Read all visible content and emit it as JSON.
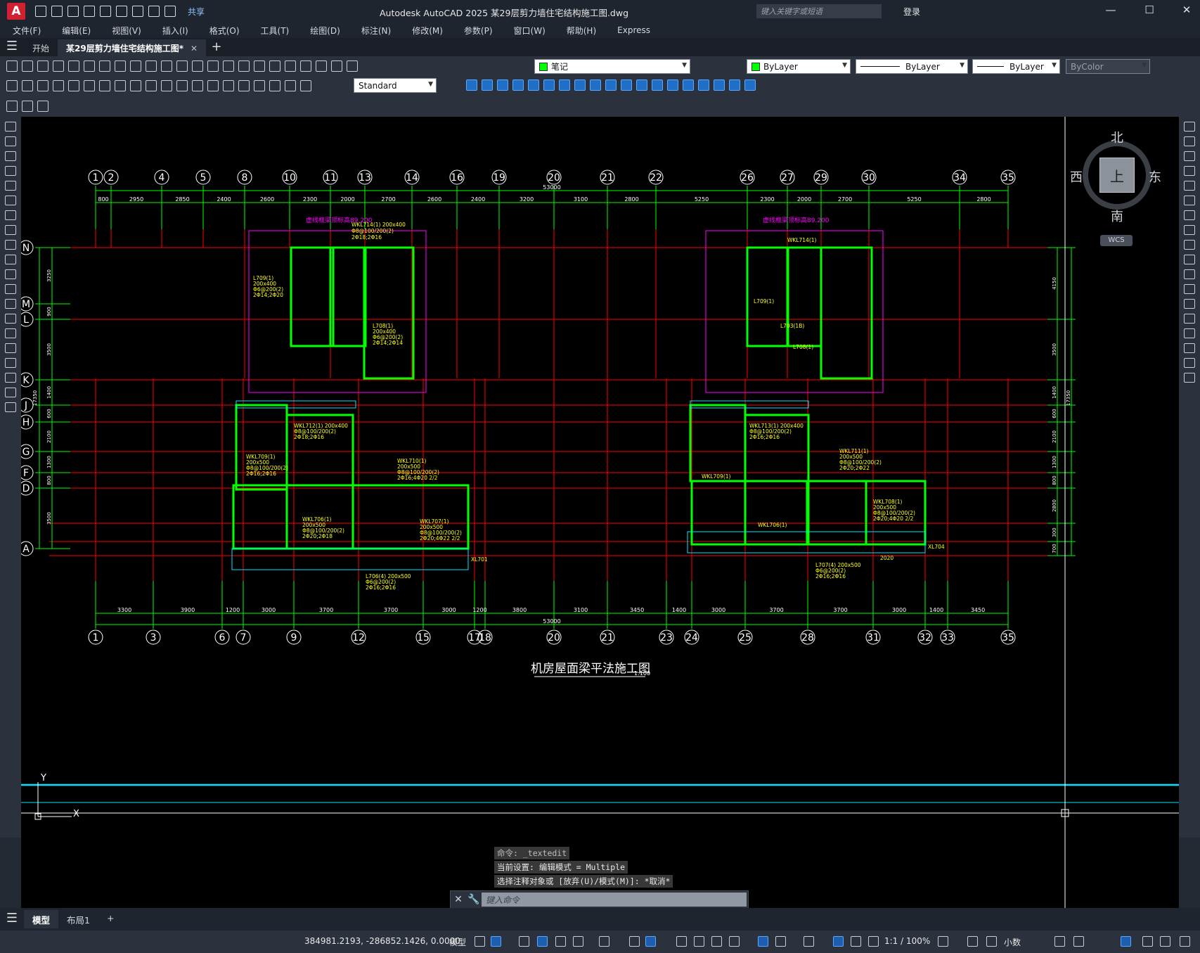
{
  "app": {
    "logo_letter": "A",
    "title": "Autodesk AutoCAD 2025    某29层剪力墙住宅结构施工图.dwg",
    "share_label": "共享",
    "search_placeholder": "键入关键字或短语",
    "login_label": "登录"
  },
  "menu": [
    "文件(F)",
    "编辑(E)",
    "视图(V)",
    "插入(I)",
    "格式(O)",
    "工具(T)",
    "绘图(D)",
    "标注(N)",
    "修改(M)",
    "参数(P)",
    "窗口(W)",
    "帮助(H)",
    "Express"
  ],
  "tabs": {
    "start": "开始",
    "document": "某29层剪力墙住宅结构施工图*"
  },
  "toolbar": {
    "layer_name": "笔记",
    "text_style": "Standard",
    "color": "ByLayer",
    "linetype": "ByLayer",
    "lineweight": "ByLayer",
    "plotstyle": "ByColor"
  },
  "viewcube": {
    "north": "北",
    "south": "南",
    "east": "东",
    "west": "西",
    "face": "上",
    "wcs": "WCS"
  },
  "drawing": {
    "title": "机房屋面梁平法施工图",
    "scale": "1:100",
    "total_dim": "53000",
    "top_axes": [
      "1",
      "2",
      "4",
      "5",
      "8",
      "10",
      "11",
      "13",
      "14",
      "16",
      "19",
      "20",
      "21",
      "22",
      "26",
      "27",
      "29",
      "30",
      "34",
      "35"
    ],
    "top_dims": [
      "800",
      "2950",
      "2850",
      "2400",
      "2600",
      "2300",
      "2000",
      "2700",
      "2600",
      "2400",
      "3200",
      "3100",
      "2800",
      "5250",
      "2300",
      "2000",
      "2700",
      "5250",
      "2800"
    ],
    "bottom_axes": [
      "1",
      "3",
      "6",
      "7",
      "9",
      "12",
      "15",
      "17",
      "18",
      "20",
      "21",
      "23",
      "24",
      "25",
      "28",
      "31",
      "32",
      "33",
      "35"
    ],
    "bottom_dims": [
      "3300",
      "3900",
      "1200",
      "3000",
      "3700",
      "3700",
      "3000",
      "1200",
      "3800",
      "3100",
      "3450",
      "1400",
      "3000",
      "3700",
      "3700",
      "3000",
      "1400",
      "3450"
    ],
    "left_axes": [
      "N",
      "M",
      "L",
      "K",
      "J",
      "H",
      "G",
      "F",
      "D",
      "A"
    ],
    "left_dims": [
      "3250",
      "900",
      "3500",
      "1400",
      "600",
      "2100",
      "1300",
      "800",
      "3500"
    ],
    "left_total": "17350",
    "right_dims": [
      "4150",
      "3500",
      "1400",
      "600",
      "2100",
      "1300",
      "800",
      "2800",
      "300",
      "700"
    ],
    "right_total": "17350",
    "note_left": "虚线框梁顶标高89.200",
    "note_right": "虚线框梁顶标高89.200",
    "beam_labels": [
      "WKL714(1) 200x400",
      "Φ8@100/200(2)",
      "2Φ18;2Φ16",
      "L709(1)",
      "200x400",
      "Φ6@200(2)",
      "2Φ14;2Φ20",
      "L708(1)",
      "200x400",
      "Φ6@200(2)",
      "2Φ14;2Φ14",
      "WKL714(1)",
      "L709(1)",
      "L703(1B)",
      "L708(1)",
      "WKL712(1) 200x400",
      "Φ8@100/200(2)",
      "2Φ18;2Φ16",
      "WKL709(1)",
      "200x500",
      "Φ8@100/200(2)",
      "2Φ16;2Φ16",
      "WKL710(1)",
      "200x500",
      "Φ8@100/200(2)",
      "2Φ16;4Φ20 2/2",
      "WKL706(1)",
      "200x500",
      "Φ8@100/200(2)",
      "2Φ20;2Φ18",
      "WKL707(1)",
      "200x500",
      "Φ8@100/200(2)",
      "2Φ20;4Φ22 2/2",
      "L706(4) 200x500",
      "Φ6@200(2)",
      "2Φ16;2Φ16",
      "WKL713(1) 200x400",
      "Φ8@100/200(2)",
      "2Φ16;2Φ16",
      "WKL711(1)",
      "200x500",
      "Φ8@100/200(2)",
      "2Φ20;2Φ22",
      "WKL708(1)",
      "200x500",
      "Φ8@100/200(2)",
      "2Φ20;4Φ20 2/2",
      "WKL709(1)",
      "WKL706(1)",
      "L707(4) 200x500",
      "Φ6@200(2)",
      "2Φ16;2Φ16",
      "XL701",
      "XL704",
      "2020"
    ]
  },
  "command": {
    "history": [
      "命令:  _textedit",
      "当前设置: 编辑模式 = Multiple",
      "选择注释对象或 [放弃(U)/模式(M)]: *取消*"
    ],
    "placeholder": "键入命令",
    "close_icon_glyph": "✕",
    "wrench_glyph": "🔧"
  },
  "ucs": {
    "x": "X",
    "y": "Y"
  },
  "layouts": [
    "模型",
    "布局1"
  ],
  "status": {
    "coords": "384981.2193, -286852.1426, 0.0000",
    "space": "模型",
    "anno_scale": "1:1 / 100%",
    "units": "小数"
  },
  "colors": {
    "canvas_bg": "#000000",
    "axis_red": "#ff0000",
    "wall_green": "#00ff00",
    "dim_green": "#00ff00",
    "text_yellow": "#ffff00",
    "frame_magenta": "#ff00ff",
    "cyan_line": "#00e5ff"
  }
}
